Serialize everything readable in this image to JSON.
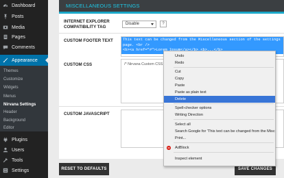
{
  "sidebar": {
    "items": [
      {
        "label": "Dashboard",
        "icon": "dashboard-icon"
      },
      {
        "label": "Posts",
        "icon": "pin-icon"
      },
      {
        "label": "Media",
        "icon": "media-icon"
      },
      {
        "label": "Pages",
        "icon": "page-icon"
      },
      {
        "label": "Comments",
        "icon": "comment-icon"
      },
      {
        "label": "Appearance",
        "icon": "brush-icon"
      },
      {
        "label": "Plugins",
        "icon": "plugin-icon"
      },
      {
        "label": "Users",
        "icon": "users-icon"
      },
      {
        "label": "Tools",
        "icon": "wrench-icon"
      },
      {
        "label": "Settings",
        "icon": "settings-icon"
      }
    ],
    "submenu": [
      "Themes",
      "Customize",
      "Widgets",
      "Menus",
      "Nirvana Settings",
      "Header",
      "Background",
      "Editor"
    ],
    "active_item": "Appearance",
    "current_subitem": "Nirvana Settings"
  },
  "section": {
    "title": "MISCELLANEOUS SETTINGS"
  },
  "fields": {
    "ie_compat": {
      "label_line1": "INTERNET EXPLORER",
      "label_line2": "COMPATIBILITY TAG",
      "value": "Disable",
      "help": "?"
    },
    "footer_text": {
      "label": "CUSTOM FOOTER TEXT",
      "value_line1": "This text can be changed from the Miscellaneous section of the settings",
      "value_line2": "page. <br />",
      "value_line3": "<b><a href=\"#\">Lorem Ipsum</a></b> <b>...</b>"
    },
    "custom_css": {
      "label": "CUSTOM CSS",
      "value": "/* Nirvana Custom CSS */"
    },
    "custom_js": {
      "label": "CUSTOM JAVASCRIPT"
    }
  },
  "buttons": {
    "reset": "RESET TO DEFAULTS",
    "save": "SAVE CHANGES"
  },
  "context_menu": {
    "items": [
      "Undo",
      "Redo",
      "Cut",
      "Copy",
      "Paste",
      "Paste as plain text",
      "Delete",
      "Spell-checker options",
      "Writing Direction",
      "Select all",
      "Search Google for 'This text can be changed from the Miscellaneous...'",
      "Print...",
      "AdBlock",
      "Inspect element"
    ],
    "highlighted": "Delete"
  },
  "colors": {
    "sidebar_bg": "#222222",
    "active_menu": "#0073aa",
    "section_title": "#1ec9e8",
    "selection": "#3399ff",
    "menu_highlight": "#3875d7"
  }
}
